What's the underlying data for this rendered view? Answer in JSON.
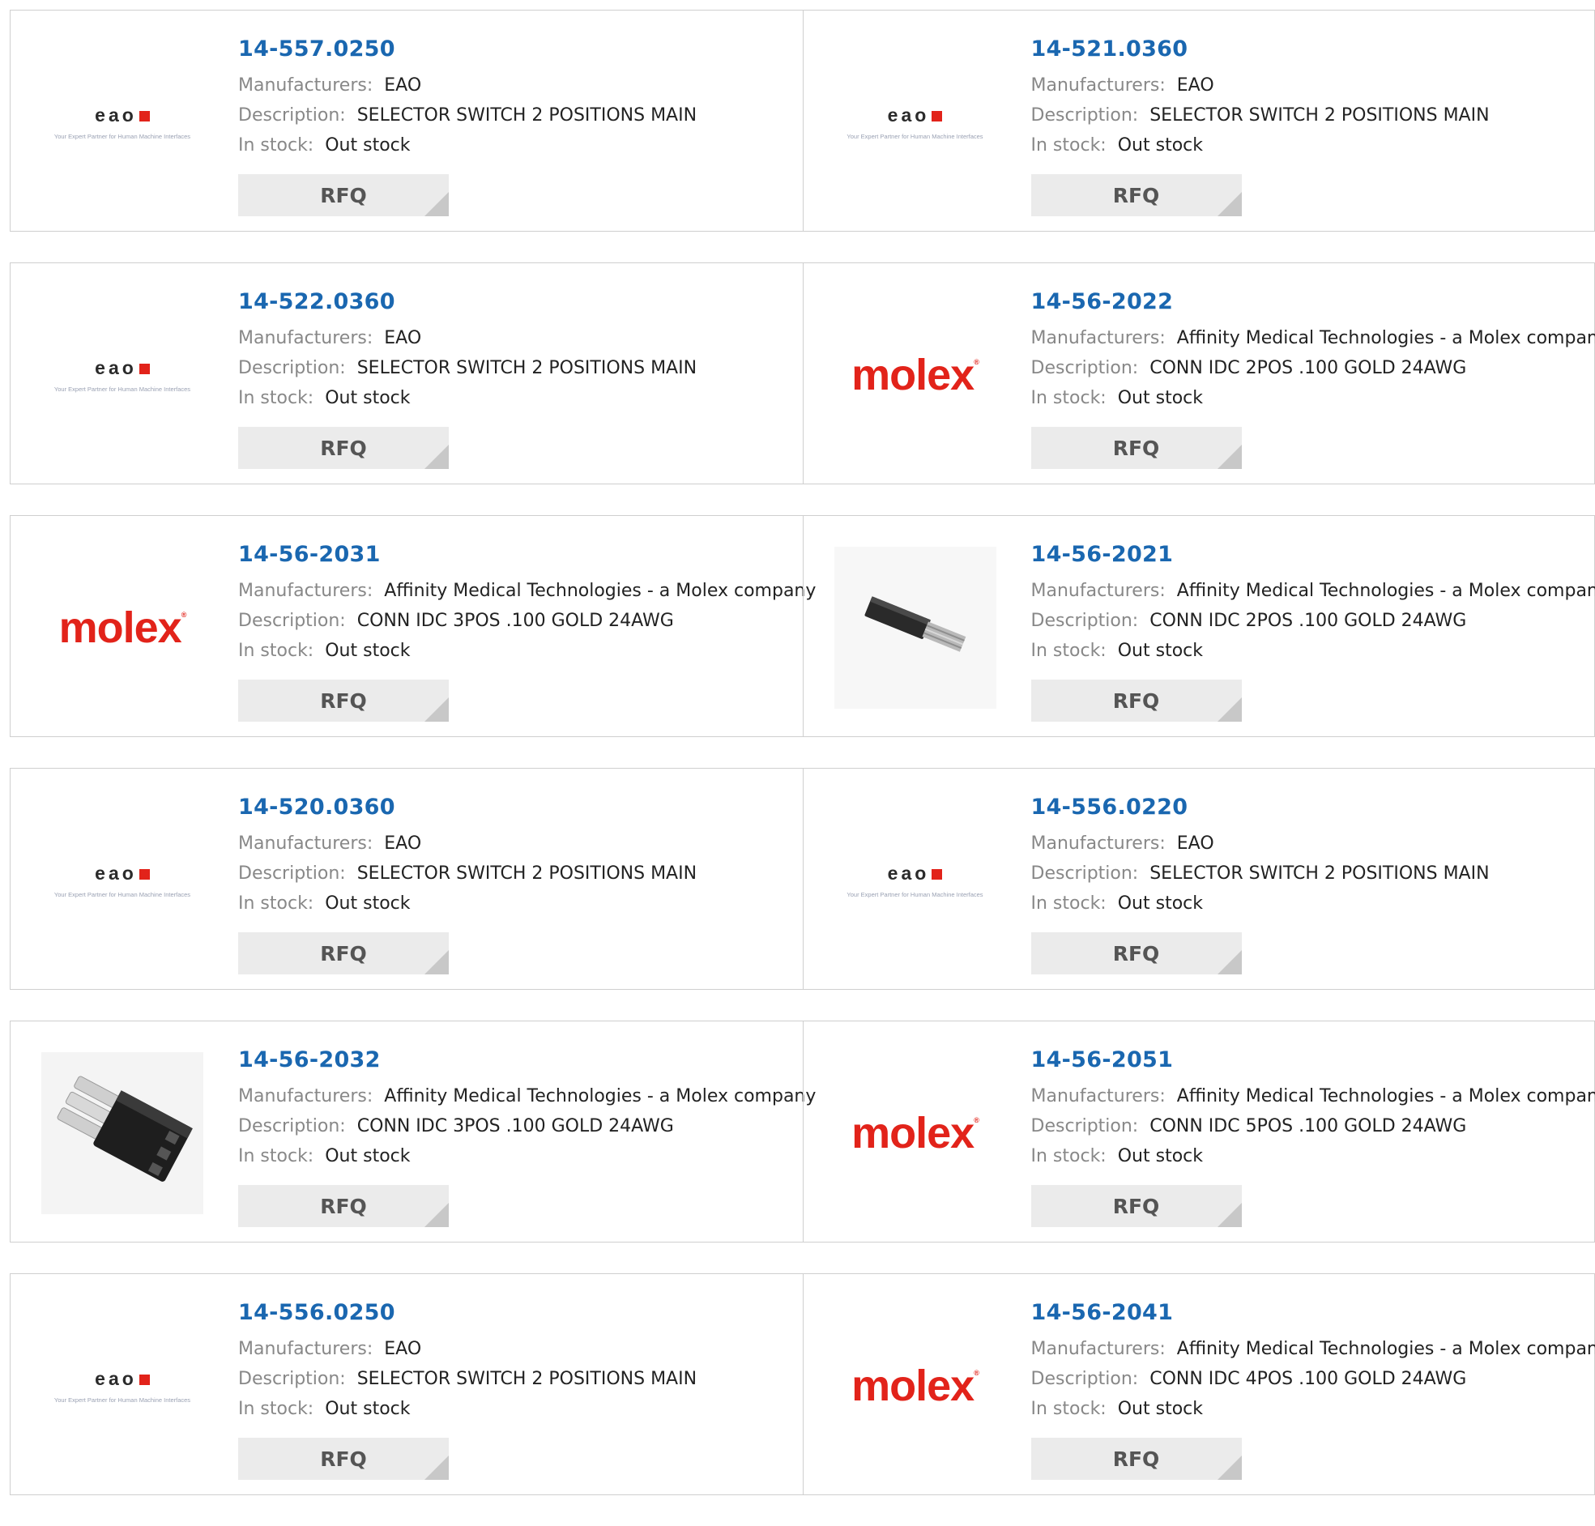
{
  "labels": {
    "manufacturers": "Manufacturers:",
    "description": "Description:",
    "in_stock": "In stock:",
    "rfq": "RFQ"
  },
  "logos": {
    "eao_word": "eao",
    "eao_tagline": "Your Expert Partner for Human Machine Interfaces",
    "molex_word": "molex"
  },
  "colors": {
    "part_link": "#1a67b0",
    "brand_red": "#e2231a",
    "label_gray": "#888888",
    "button_bg": "#ebebeb"
  },
  "products": [
    {
      "part": "14-557.0250",
      "manufacturer": "EAO",
      "description": "SELECTOR SWITCH 2 POSITIONS MAIN",
      "stock": "Out stock",
      "image": "eao-logo"
    },
    {
      "part": "14-521.0360",
      "manufacturer": "EAO",
      "description": "SELECTOR SWITCH 2 POSITIONS MAIN",
      "stock": "Out stock",
      "image": "eao-logo"
    },
    {
      "part": "14-522.0360",
      "manufacturer": "EAO",
      "description": "SELECTOR SWITCH 2 POSITIONS MAIN",
      "stock": "Out stock",
      "image": "eao-logo"
    },
    {
      "part": "14-56-2022",
      "manufacturer": "Affinity Medical Technologies - a Molex company",
      "description": "CONN IDC 2POS .100 GOLD 24AWG",
      "stock": "Out stock",
      "image": "molex-logo"
    },
    {
      "part": "14-56-2031",
      "manufacturer": "Affinity Medical Technologies - a Molex company",
      "description": "CONN IDC 3POS .100 GOLD 24AWG",
      "stock": "Out stock",
      "image": "molex-logo"
    },
    {
      "part": "14-56-2021",
      "manufacturer": "Affinity Medical Technologies - a Molex company",
      "description": "CONN IDC 2POS .100 GOLD 24AWG",
      "stock": "Out stock",
      "image": "connector-photo-2pos"
    },
    {
      "part": "14-520.0360",
      "manufacturer": "EAO",
      "description": "SELECTOR SWITCH 2 POSITIONS MAIN",
      "stock": "Out stock",
      "image": "eao-logo"
    },
    {
      "part": "14-556.0220",
      "manufacturer": "EAO",
      "description": "SELECTOR SWITCH 2 POSITIONS MAIN",
      "stock": "Out stock",
      "image": "eao-logo"
    },
    {
      "part": "14-56-2032",
      "manufacturer": "Affinity Medical Technologies - a Molex company",
      "description": "CONN IDC 3POS .100 GOLD 24AWG",
      "stock": "Out stock",
      "image": "connector-photo-3pos"
    },
    {
      "part": "14-56-2051",
      "manufacturer": "Affinity Medical Technologies - a Molex company",
      "description": "CONN IDC 5POS .100 GOLD 24AWG",
      "stock": "Out stock",
      "image": "molex-logo"
    },
    {
      "part": "14-556.0250",
      "manufacturer": "EAO",
      "description": "SELECTOR SWITCH 2 POSITIONS MAIN",
      "stock": "Out stock",
      "image": "eao-logo"
    },
    {
      "part": "14-56-2041",
      "manufacturer": "Affinity Medical Technologies - a Molex company",
      "description": "CONN IDC 4POS .100 GOLD 24AWG",
      "stock": "Out stock",
      "image": "molex-logo"
    }
  ]
}
